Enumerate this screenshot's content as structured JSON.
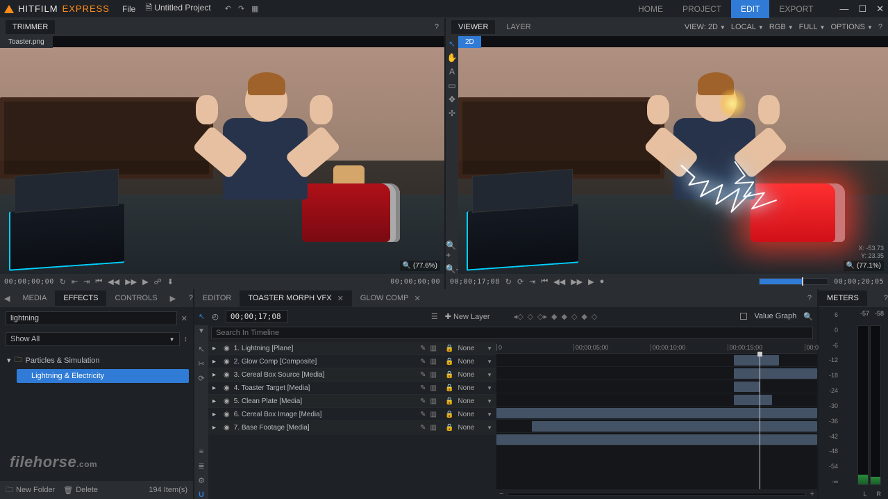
{
  "app": {
    "name_a": "HITFILM",
    "name_b": "EXPRESS"
  },
  "menu": {
    "file": "File",
    "project_doc": "Untitled Project"
  },
  "nav": {
    "home": "HOME",
    "project": "PROJECT",
    "edit": "EDIT",
    "export": "EXPORT"
  },
  "panels": {
    "trimmer": "TRIMMER",
    "viewer": "VIEWER",
    "layer": "LAYER",
    "meters": "METERS"
  },
  "viewer_opts": {
    "view": "VIEW: 2D",
    "local": "LOCAL",
    "rgb": "RGB",
    "full": "FULL",
    "options": "OPTIONS"
  },
  "trimmer": {
    "file_tab": "Toaster.png",
    "zoom": "(77.6%)",
    "tc_left": "00;00;00;00",
    "tc_right": "00;00;00;00"
  },
  "viewer": {
    "view_tab": "2D",
    "zoom": "(77.1%)",
    "coord_x": "X: -53.73",
    "coord_y": "Y:   23.35",
    "tc_left": "00;00;17;08",
    "tc_right": "00;00;20;05"
  },
  "left_tabs": {
    "media": "MEDIA",
    "effects": "EFFECTS",
    "controls": "CONTROLS"
  },
  "effects": {
    "search": "lightning",
    "filter": "Show All",
    "folder": "Particles & Simulation",
    "item": "Lightning & Electricity",
    "new_folder": "New Folder",
    "delete": "Delete",
    "count": "194 Item(s)"
  },
  "editor_tabs": {
    "editor": "EDITOR",
    "comp1": "TOASTER MORPH VFX",
    "comp2": "GLOW COMP"
  },
  "editor": {
    "timecode": "00;00;17;08",
    "new_layer": "New Layer",
    "search_ph": "Search In Timeline",
    "value_graph": "Value Graph",
    "ruler": [
      "0",
      "00;00;05;00",
      "00;00;10;00",
      "00;00;15;00",
      "00;0"
    ],
    "layers": [
      {
        "n": "1.",
        "name": "Lightning [Plane]",
        "blend": "None"
      },
      {
        "n": "2.",
        "name": "Glow Comp [Composite]",
        "blend": "None"
      },
      {
        "n": "3.",
        "name": "Cereal Box Source [Media]",
        "blend": "None"
      },
      {
        "n": "4.",
        "name": "Toaster Target [Media]",
        "blend": "None"
      },
      {
        "n": "5.",
        "name": "Clean Plate [Media]",
        "blend": "None"
      },
      {
        "n": "6.",
        "name": "Cereal Box Image [Media]",
        "blend": "None"
      },
      {
        "n": "7.",
        "name": "Base Footage [Media]",
        "blend": "None"
      }
    ]
  },
  "meters": {
    "scale": [
      "6",
      "0",
      "-6",
      "-12",
      "-18",
      "-24",
      "-30",
      "-36",
      "-42",
      "-48",
      "-54",
      "-∞"
    ],
    "L": "L",
    "R": "R",
    "peak_l": "-57",
    "peak_r": "-58"
  },
  "watermark": {
    "a": "filehorse",
    "b": ".com"
  }
}
